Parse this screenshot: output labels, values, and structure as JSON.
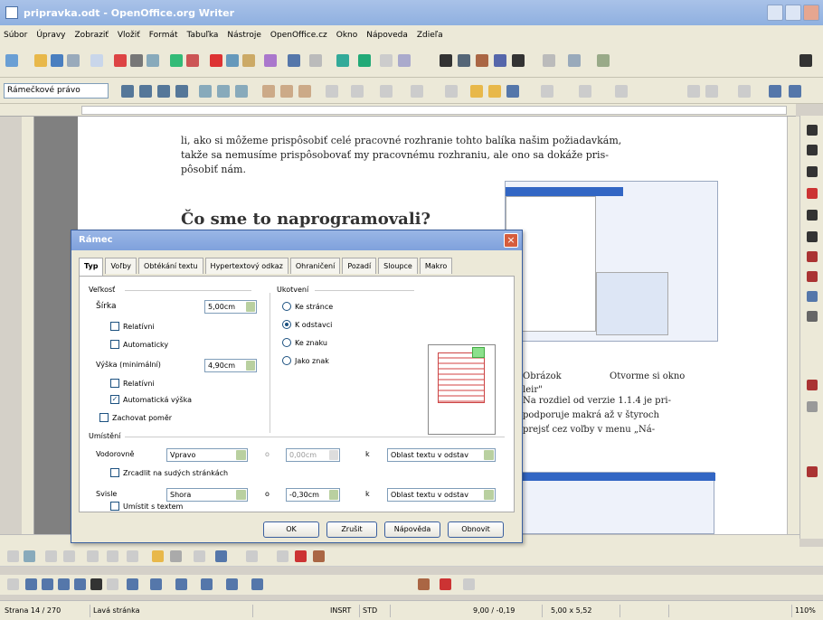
{
  "window": {
    "title": "pripravka.odt - OpenOffice.org Writer"
  },
  "menu": [
    "Súbor",
    "Úpravy",
    "Zobraziť",
    "Vložiť",
    "Formát",
    "Tabuľka",
    "Nástroje",
    "OpenOffice.cz",
    "Okno",
    "Nápoveda",
    "Zdieľa"
  ],
  "formatting": {
    "style": "Rámečkové právo"
  },
  "document": {
    "paragraph_lines": [
      "li, ako si môžeme prispôsobiť celé pracovné rozhranie tohto balíka našim požiadavkám,",
      "takže sa nemusíme prispôsobovať my pracovnému rozhraniu, ale ono sa dokáže pris-",
      "pôsobiť nám."
    ],
    "heading": "Čo sme to naprogramovali?",
    "right_lines_1": [
      "Obrázok",
      "Otvorme si okno",
      "leir\""
    ],
    "right_lines_2": [
      "Na rozdiel od verzie 1.1.4 je pri-",
      "podporuje makrá až v štyroch",
      "prejsť cez voľby v menu „Ná-"
    ]
  },
  "dialog": {
    "title": "Rámec",
    "close": "×",
    "tabs": [
      "Typ",
      "Voľby",
      "Obtékání textu",
      "Hypertextový odkaz",
      "Ohraničení",
      "Pozadí",
      "Sloupce",
      "Makro"
    ],
    "size": {
      "group": "Veľkosť",
      "width_label": "Šírka",
      "width_value": "5,00cm",
      "relative_1": "Relatívni",
      "automatic": "Automaticky",
      "height_label": "Výška (minimální)",
      "height_value": "4,90cm",
      "relative_2": "Relatívni",
      "auto_height": "Automatická výška",
      "keep_ratio": "Zachovat poměr"
    },
    "anchor": {
      "group": "Ukotvení",
      "options": [
        "Ke stránce",
        "K odstavci",
        "Ke znaku",
        "Jako znak"
      ],
      "selected": 1
    },
    "position": {
      "group": "Umístění",
      "horizontal_label": "Vodorovně",
      "horizontal_value": "Vpravo",
      "horizontal_by": "o",
      "horizontal_offset": "0,00cm",
      "horizontal_to": "k",
      "horizontal_ref": "Oblast textu v odstav",
      "mirror": "Zrcadlit na sudých stránkách",
      "vertical_label": "Svisle",
      "vertical_value": "Shora",
      "vertical_by": "o",
      "vertical_offset": "-0,30cm",
      "vertical_to": "k",
      "vertical_ref": "Oblast textu v odstav",
      "keep_inside": "Umístit s textem"
    },
    "buttons": {
      "ok": "OK",
      "cancel": "Zrušit",
      "help": "Nápověda",
      "reset": "Obnovit"
    }
  },
  "status": {
    "page": "Strana 14 / 270",
    "style": "Lavá stránka",
    "insert": "INSRT",
    "sel": "STD",
    "position": "9,00 / -0,19",
    "size": "5,00 x 5,52",
    "zoom": "110%"
  },
  "colors": {
    "titlebar": "#8fb0e0",
    "accent": "#1c5180",
    "spin_arrow": "#b9d0a0"
  }
}
